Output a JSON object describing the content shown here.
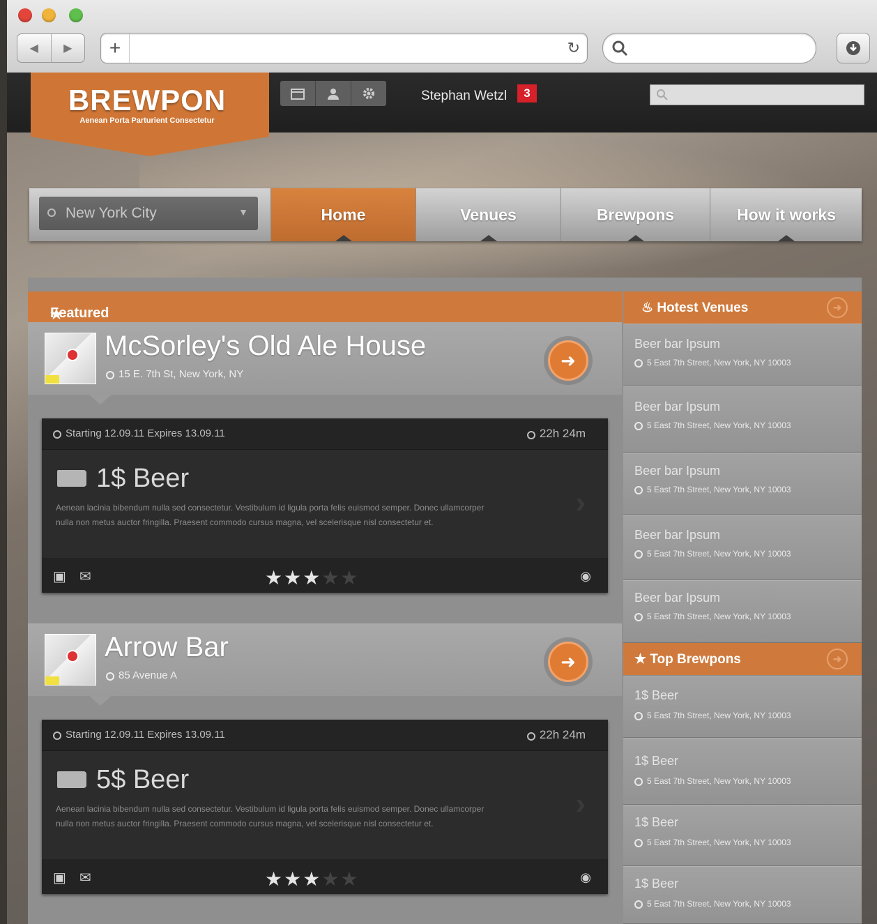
{
  "browser": {
    "nav_back": "◀",
    "nav_forward": "▶",
    "new_tab": "+",
    "reload": "↻"
  },
  "header": {
    "brand": "BREWPON",
    "tagline": "Aenean Porta Parturient Consectetur",
    "user_name": "Stephan Wetzl",
    "notifications": "3"
  },
  "nav": {
    "city": "New York City",
    "tabs": [
      {
        "label": "Home",
        "active": true
      },
      {
        "label": "Venues",
        "active": false
      },
      {
        "label": "Brewpons",
        "active": false
      },
      {
        "label": "How it works",
        "active": false
      }
    ]
  },
  "featured": {
    "title": "Featured",
    "items": [
      {
        "venue": "McSorley's Old Ale House",
        "address": "15 E. 7th St, New York, NY",
        "deal_dates": "Starting 12.09.11   Expires 13.09.11",
        "time_left": "22h 24m",
        "deal_title": "1$ Beer",
        "description": "Aenean lacinia bibendum nulla sed consectetur. Vestibulum id ligula porta felis euismod semper. Donec ullamcorper nulla non metus auctor fringilla. Praesent commodo cursus magna, vel scelerisque nisl consectetur et.",
        "rating": 3,
        "rating_max": 5
      },
      {
        "venue": "Arrow Bar",
        "address": "85 Avenue A",
        "deal_dates": "Starting 12.09.11   Expires 13.09.11",
        "time_left": "22h 24m",
        "deal_title": "5$ Beer",
        "description": "Aenean lacinia bibendum nulla sed consectetur. Vestibulum id ligula porta felis euismod semper. Donec ullamcorper nulla non metus auctor fringilla. Praesent commodo cursus magna, vel scelerisque nisl consectetur et.",
        "rating": 3,
        "rating_max": 5
      }
    ]
  },
  "hottest_venues": {
    "title": "Hotest Venues",
    "items": [
      {
        "name": "Beer bar Ipsum",
        "address": "5 East 7th Street, New York, NY 10003"
      },
      {
        "name": "Beer bar Ipsum",
        "address": "5 East 7th Street, New York, NY 10003"
      },
      {
        "name": "Beer bar Ipsum",
        "address": "5 East 7th Street, New York, NY 10003"
      },
      {
        "name": "Beer bar Ipsum",
        "address": "5 East 7th Street, New York, NY 10003"
      },
      {
        "name": "Beer bar Ipsum",
        "address": "5 East 7th Street, New York, NY 10003"
      }
    ]
  },
  "top_brewpons": {
    "title": "Top Brewpons",
    "items": [
      {
        "name": "1$ Beer",
        "address": "5 East 7th Street, New York, NY 10003"
      },
      {
        "name": "1$ Beer",
        "address": "5 East 7th Street, New York, NY 10003"
      },
      {
        "name": "1$ Beer",
        "address": "5 East 7th Street, New York, NY 10003"
      },
      {
        "name": "1$ Beer",
        "address": "5 East 7th Street, New York, NY 10003"
      }
    ]
  },
  "colors": {
    "accent": "#cf7a3c",
    "badge": "#d6202a"
  },
  "icons": [
    "search-icon",
    "calendar-icon",
    "user-icon",
    "gear-icon",
    "fire-icon",
    "star-icon",
    "clock-icon",
    "tag-icon",
    "eye-icon",
    "arrow-circle-icon"
  ]
}
